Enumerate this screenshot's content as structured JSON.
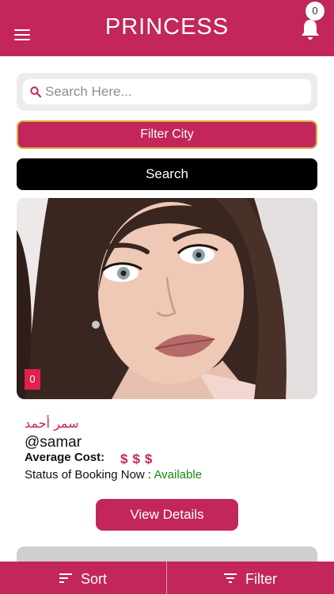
{
  "header": {
    "title": "PRINCESS",
    "notification_count": "0",
    "menu_icon": "hamburger-menu-icon",
    "bell_icon": "bell-icon"
  },
  "search": {
    "placeholder": "Search Here...",
    "value": "",
    "icon": "search-icon"
  },
  "filter_city_label": "Filter City",
  "search_button_label": "Search",
  "card": {
    "photo_count": "0",
    "name_arabic": "سمر أحمد",
    "username": "@samar",
    "average_cost_label": "Average Cost:",
    "cost_symbols": "$$$",
    "status_label": "Status of Booking Now :",
    "status_value": "Available",
    "view_details_label": "View Details"
  },
  "bottom_bar": {
    "sort_label": "Sort",
    "filter_label": "Filter",
    "sort_icon": "sort-icon",
    "filter_icon": "filter-icon"
  },
  "colors": {
    "brand": "#c2265a",
    "status_available": "#138a13",
    "filter_border": "#d4b23a"
  }
}
